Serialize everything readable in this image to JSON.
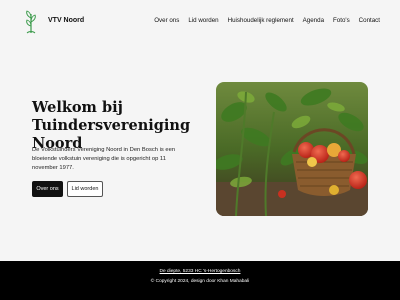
{
  "site": {
    "name": "VTV Noord"
  },
  "nav": {
    "items": [
      {
        "label": "Over ons"
      },
      {
        "label": "Lid worden"
      },
      {
        "label": "Huishoudelijk reglement"
      },
      {
        "label": "Agenda"
      },
      {
        "label": "Foto's"
      },
      {
        "label": "Contact"
      }
    ]
  },
  "hero": {
    "title_line1": "Welkom bij",
    "title_line2": "Tuindersvereniging Noord",
    "text": "De Volkstuinders Vereniging Noord in Den Bosch is een bloeiende volkstuin vereniging die is opgericht op 11 november 1977.",
    "primary_button": "Over ons",
    "secondary_button": "Lid worden",
    "image": "tomatoes-basket-photo"
  },
  "footer": {
    "address": "De diepte, 5233 HC 's-Hertogenbosch",
    "copyright": "© Copyright 2024, design door Khan Mahabali"
  },
  "colors": {
    "background": "#f5f5f5",
    "footer": "#000000",
    "primary_button": "#111111",
    "logo_green": "#3a9a4a"
  }
}
